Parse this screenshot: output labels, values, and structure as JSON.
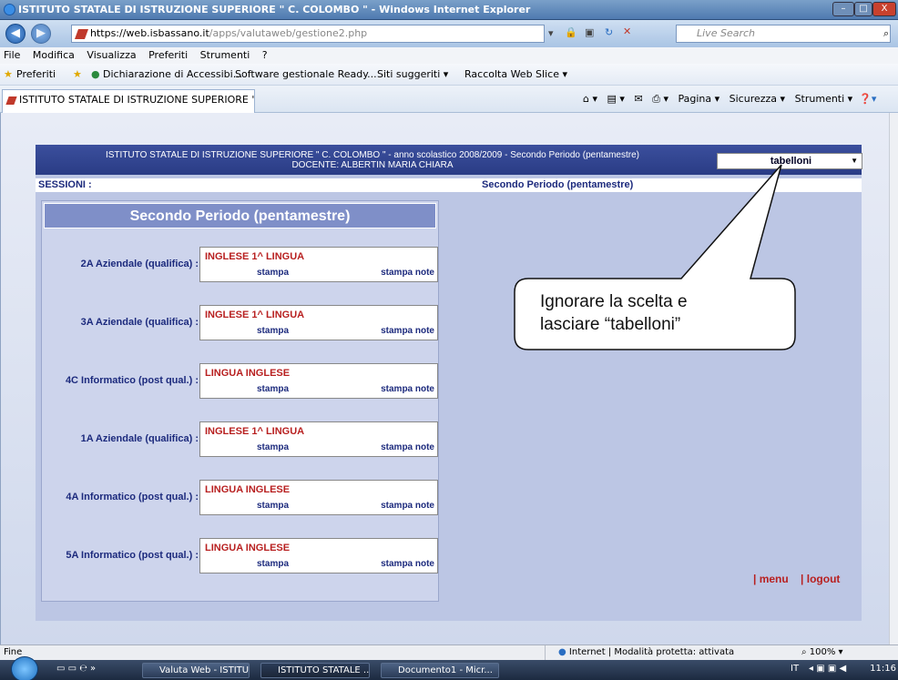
{
  "window": {
    "title": "ISTITUTO STATALE DI ISTRUZIONE SUPERIORE \" C. COLOMBO \" - Windows Internet Explorer",
    "min": "–",
    "max": "□",
    "close": "X"
  },
  "browser": {
    "url_domain": "https://web.isbassano.it",
    "url_path": "/apps/valutaweb/gestione2.php",
    "search_placeholder": "Live Search",
    "menu": [
      "File",
      "Modifica",
      "Visualizza",
      "Preferiti",
      "Strumenti",
      "?"
    ],
    "favorites_label": "Preferiti",
    "favorites": [
      "Dichiarazione di Accessibi...",
      "Software gestionale Ready...",
      "Siti suggeriti ▾",
      "Raccolta Web Slice ▾"
    ],
    "tab_title": "ISTITUTO STATALE DI ISTRUZIONE SUPERIORE \" ...",
    "tab_tools": [
      "Pagina ▾",
      "Sicurezza ▾",
      "Strumenti ▾"
    ]
  },
  "page": {
    "header_line1": "ISTITUTO STATALE DI ISTRUZIONE SUPERIORE \" C. COLOMBO \" - anno scolastico 2008/2009 - Secondo Periodo (pentamestre)",
    "header_line2": "DOCENTE: ALBERTIN MARIA CHIARA",
    "session_select": "tabelloni",
    "sessions_label": "SESSIONI :",
    "sessions_period": "Secondo Periodo (pentamestre)",
    "panel_title": "Secondo Periodo (pentamestre)",
    "stampa": "stampa",
    "stampa_note": "stampa note",
    "classes": [
      {
        "name": "2A Aziendale (qualifica) :",
        "subject": "INGLESE 1^ LINGUA"
      },
      {
        "name": "3A Aziendale (qualifica) :",
        "subject": "INGLESE 1^ LINGUA"
      },
      {
        "name": "4C Informatico (post qual.) :",
        "subject": "LINGUA INGLESE"
      },
      {
        "name": "1A Aziendale (qualifica) :",
        "subject": "INGLESE 1^ LINGUA"
      },
      {
        "name": "4A Informatico (post qual.) :",
        "subject": "LINGUA INGLESE"
      },
      {
        "name": "5A Informatico (post qual.) :",
        "subject": "LINGUA INGLESE"
      }
    ],
    "menu_link": "| menu",
    "logout_link": "| logout"
  },
  "callout": {
    "line1": "Ignorare la scelta e",
    "line2": "lasciare “tabelloni”"
  },
  "status": {
    "left": "Fine",
    "zone": "Internet | Modalità protetta: attivata",
    "zoom": "100%"
  },
  "taskbar": {
    "items": [
      "Valuta Web - ISTITU...",
      "ISTITUTO STATALE ...",
      "Documento1 - Micr..."
    ],
    "lang": "IT",
    "clock": "11:16"
  },
  "colors": {
    "header": "#2a3c85",
    "accent_red": "#b82020",
    "label_blue": "#1c2a7d"
  }
}
